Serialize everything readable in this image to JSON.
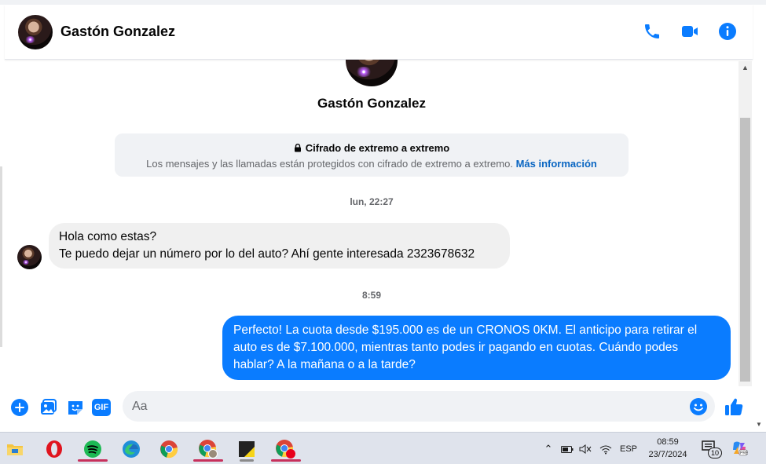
{
  "header": {
    "contact_name": "Gastón Gonzalez",
    "actions": [
      {
        "icon": "phone-icon"
      },
      {
        "icon": "video-camera-icon"
      },
      {
        "icon": "info-icon"
      }
    ]
  },
  "conversation": {
    "profile_name": "Gastón Gonzalez",
    "encryption": {
      "title": "Cifrado de extremo a extremo",
      "body": "Los mensajes y las llamadas están protegidos con cifrado de extremo a extremo.",
      "link": "Más información"
    },
    "messages": [
      {
        "timestamp": "lun, 22:27",
        "direction": "incoming",
        "lines": [
          "Hola como estas?",
          "Te puedo dejar un número por lo del auto? Ahí gente interesada 2323678632"
        ]
      },
      {
        "timestamp": "8:59",
        "direction": "outgoing",
        "text": "Perfecto! La cuota desde $195.000 es de un CRONOS 0KM. El anticipo para retirar el auto es de $7.100.000, mientras tanto podes ir pagando en cuotas. Cuándo podes hablar? A la mañana o a la tarde?"
      }
    ]
  },
  "composer": {
    "placeholder": "Aa",
    "value": "",
    "buttons": [
      "plus-icon",
      "gallery-icon",
      "sticker-icon",
      "gif-icon",
      "emoji-icon",
      "thumbs-up-icon"
    ],
    "gif_label": "GIF"
  },
  "taskbar": {
    "apps": [
      "file-explorer",
      "opera",
      "spotify",
      "edge",
      "chrome",
      "chrome-profile",
      "sticky-notes",
      "chrome-recording"
    ],
    "tray": {
      "language": "ESP",
      "time": "08:59",
      "date": "23/7/2024",
      "notifications": "10"
    }
  },
  "colors": {
    "accent": "#0a7cff",
    "link": "#0a66c2",
    "incoming_bubble": "#f0f0f0",
    "taskbar": "#dfe3ec"
  }
}
